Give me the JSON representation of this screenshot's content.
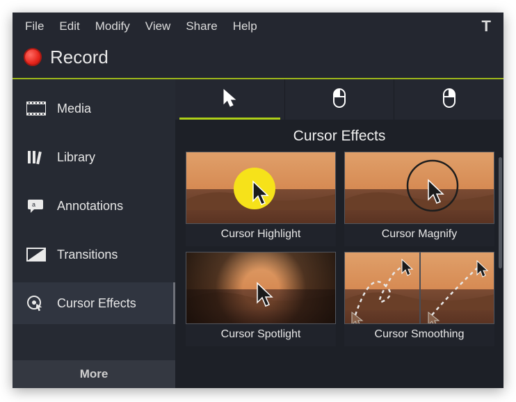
{
  "menubar": {
    "items": [
      "File",
      "Edit",
      "Modify",
      "View",
      "Share",
      "Help"
    ],
    "corner": "T"
  },
  "record": {
    "label": "Record"
  },
  "sidebar": {
    "items": [
      {
        "label": "Media"
      },
      {
        "label": "Library"
      },
      {
        "label": "Annotations"
      },
      {
        "label": "Transitions"
      },
      {
        "label": "Cursor Effects"
      }
    ],
    "more_label": "More"
  },
  "main": {
    "panel_title": "Cursor Effects",
    "effects": [
      {
        "label": "Cursor Highlight"
      },
      {
        "label": "Cursor Magnify"
      },
      {
        "label": "Cursor Spotlight"
      },
      {
        "label": "Cursor Smoothing"
      }
    ]
  },
  "colors": {
    "accent": "#aecf18",
    "record": "#e7261d"
  }
}
